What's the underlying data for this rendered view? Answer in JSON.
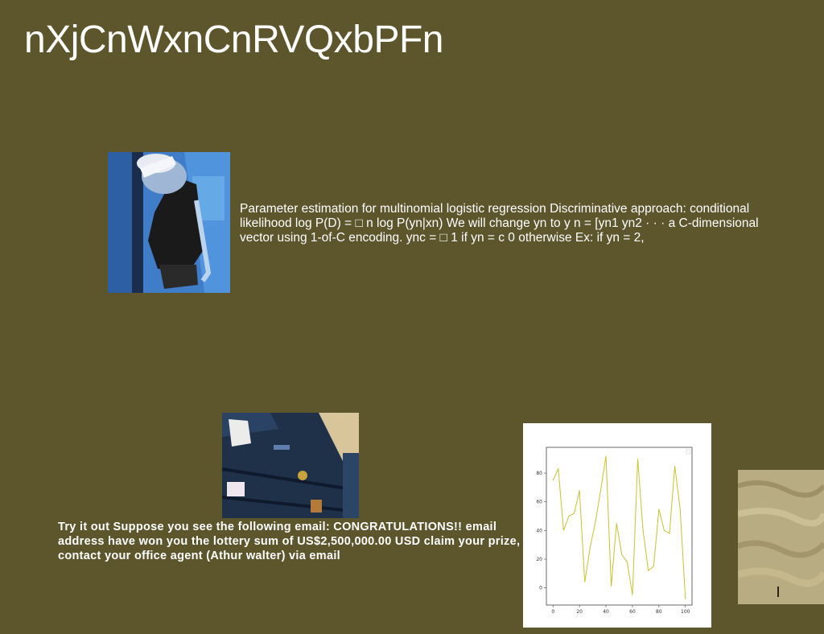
{
  "page": {
    "title": "nXjCnWxnCnRVQxbPFn"
  },
  "blocks": {
    "parameter_text": "Parameter estimation for multinomial logistic regression Discriminative approach: conditional likelihood log P(D) = □ n log P(yn|xn) We will change yn to y n = [yn1 yn2 · · · a C-dimensional vector using 1-of-C encoding. ync = □ 1 if yn = c 0 otherwise Ex: if yn = 2,",
    "email_text": "Try it out Suppose you see the following email: CONGRATULATIONS!! email address have won you the lottery sum of US$2,500,000.00 USD claim your prize, contact your office agent (Athur walter) via email"
  },
  "colors": {
    "background": "#5d552c",
    "text": "#ffffff",
    "line": "#c8c234"
  },
  "chart_data": {
    "type": "line",
    "x": [
      0,
      4,
      8,
      12,
      16,
      20,
      24,
      28,
      32,
      36,
      40,
      44,
      48,
      52,
      56,
      60,
      64,
      68,
      72,
      76,
      80,
      84,
      88,
      92,
      96,
      100
    ],
    "y": [
      75,
      83,
      40,
      50,
      52,
      68,
      4,
      28,
      46,
      68,
      92,
      1,
      45,
      23,
      18,
      -5,
      90,
      40,
      12,
      15,
      55,
      40,
      38,
      85,
      55,
      -8
    ],
    "xticks": [
      0,
      20,
      40,
      60,
      80,
      100
    ],
    "yticks": [
      0,
      20,
      40,
      60,
      80
    ],
    "xlim": [
      -5,
      105
    ],
    "ylim": [
      -12,
      98
    ],
    "grid": false
  }
}
